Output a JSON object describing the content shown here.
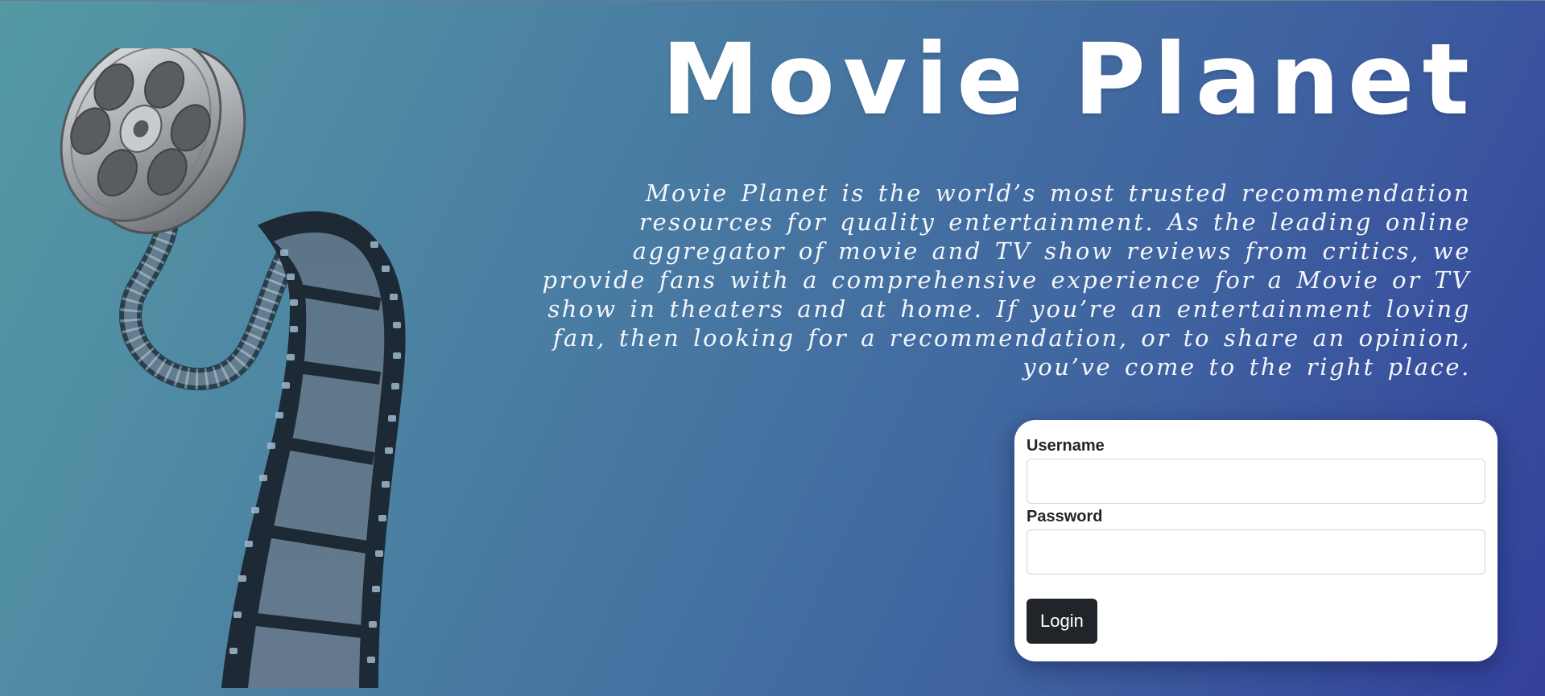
{
  "hero": {
    "title": "Movie Planet",
    "description": "Movie Planet is the world’s most trusted recommendation resources for quality entertainment. As the leading online aggregator of movie and TV show reviews from critics, we provide fans with a comprehensive experience for a Movie or TV show in theaters and at home. If you’re an entertainment loving fan, then looking for a recommendation, or to share an opinion, you’ve come to the right place."
  },
  "login": {
    "username_label": "Username",
    "username_value": "",
    "password_label": "Password",
    "password_value": "",
    "button_label": "Login"
  },
  "illustration": {
    "icon": "film-reel-icon"
  },
  "colors": {
    "bg_start": "#5599a4",
    "bg_end": "#33409b",
    "button_bg": "#212529"
  }
}
